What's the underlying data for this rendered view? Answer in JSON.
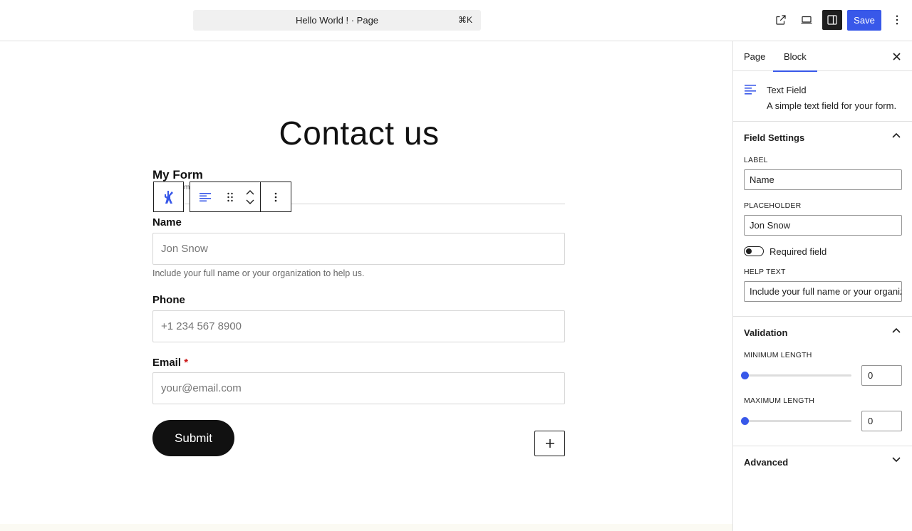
{
  "header": {
    "document_title": "Hello World ! · Page",
    "shortcut": "⌘K",
    "save_label": "Save",
    "accent_color": "#3858e9"
  },
  "canvas": {
    "page_title": "Contact us",
    "form_title": "My Form",
    "behind_text": "m",
    "fields": [
      {
        "label": "Name",
        "placeholder": "Jon Snow",
        "help": "Include your full name or your organization to help us.",
        "required": false
      },
      {
        "label": "Phone",
        "placeholder": "+1 234 567 8900",
        "help": "",
        "required": false
      },
      {
        "label": "Email",
        "placeholder": "your@email.com",
        "help": "",
        "required": true,
        "required_mark": "*"
      }
    ],
    "submit_label": "Submit",
    "add_block_symbol": "+"
  },
  "sidebar": {
    "tabs": [
      {
        "label": "Page",
        "active": false
      },
      {
        "label": "Block",
        "active": true
      }
    ],
    "block": {
      "name": "Text Field",
      "description": "A simple text field for your form.",
      "icon": "text-align-left-icon"
    },
    "field_settings": {
      "title": "Field Settings",
      "label_caption": "LABEL",
      "label_value": "Name",
      "placeholder_caption": "PLACEHOLDER",
      "placeholder_value": "Jon Snow",
      "required_label": "Required field",
      "required_on": false,
      "help_caption": "HELP TEXT",
      "help_value": "Include your full name or your organization to help us."
    },
    "validation": {
      "title": "Validation",
      "min_caption": "MINIMUM LENGTH",
      "min_value": "0",
      "max_caption": "MAXIMUM LENGTH",
      "max_value": "0"
    },
    "advanced": {
      "title": "Advanced"
    }
  }
}
